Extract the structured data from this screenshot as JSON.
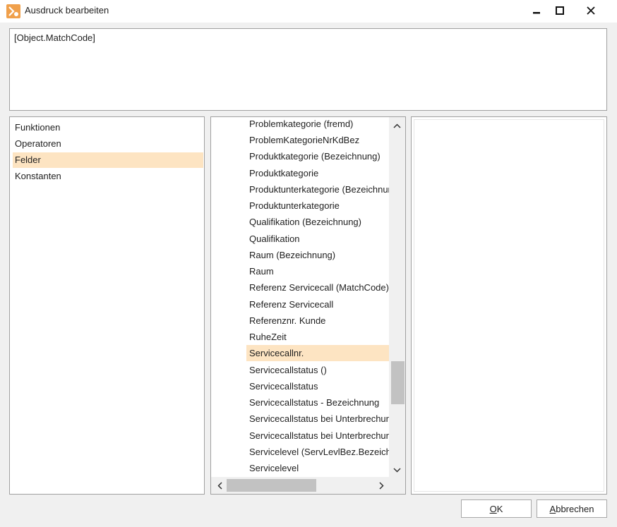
{
  "window": {
    "title": "Ausdruck bearbeiten",
    "icon": "expression-editor-icon",
    "controls": {
      "minimize": "minimize-icon",
      "maximize": "maximize-icon",
      "close": "close-icon"
    }
  },
  "expression": {
    "value": "[Object.MatchCode]"
  },
  "categories": {
    "items": [
      {
        "label": "Funktionen",
        "selected": false
      },
      {
        "label": "Operatoren",
        "selected": false
      },
      {
        "label": "Felder",
        "selected": true
      },
      {
        "label": "Konstanten",
        "selected": false
      }
    ]
  },
  "fields": {
    "items": [
      {
        "label": "Problemkategorie (fremd)",
        "selected": false
      },
      {
        "label": "ProblemKategorieNrKdBez",
        "selected": false
      },
      {
        "label": "Produktkategorie (Bezeichnung)",
        "selected": false
      },
      {
        "label": "Produktkategorie",
        "selected": false
      },
      {
        "label": "Produktunterkategorie (Bezeichnung)",
        "selected": false
      },
      {
        "label": "Produktunterkategorie",
        "selected": false
      },
      {
        "label": "Qualifikation (Bezeichnung)",
        "selected": false
      },
      {
        "label": "Qualifikation",
        "selected": false
      },
      {
        "label": "Raum (Bezeichnung)",
        "selected": false
      },
      {
        "label": "Raum",
        "selected": false
      },
      {
        "label": "Referenz Servicecall (MatchCode)",
        "selected": false
      },
      {
        "label": "Referenz Servicecall",
        "selected": false
      },
      {
        "label": "Referenznr. Kunde",
        "selected": false
      },
      {
        "label": "RuheZeit",
        "selected": false
      },
      {
        "label": "Servicecallnr.",
        "selected": true
      },
      {
        "label": "Servicecallstatus ()",
        "selected": false
      },
      {
        "label": "Servicecallstatus",
        "selected": false
      },
      {
        "label": "Servicecallstatus - Bezeichnung",
        "selected": false
      },
      {
        "label": "Servicecallstatus bei Unterbrechung",
        "selected": false
      },
      {
        "label": "Servicecallstatus bei Unterbrechung",
        "selected": false
      },
      {
        "label": "Servicelevel (ServLevlBez.Bezeichnung)",
        "selected": false
      },
      {
        "label": "Servicelevel",
        "selected": false
      }
    ]
  },
  "buttons": {
    "ok": {
      "mnemonic": "O",
      "rest": "K"
    },
    "cancel": {
      "mnemonic": "A",
      "rest": "bbrechen"
    }
  },
  "colors": {
    "selection": "#fde4c2",
    "accent_icon": "#f0a04b",
    "window_bg": "#f0f0f0",
    "border": "#a0a0a0"
  }
}
